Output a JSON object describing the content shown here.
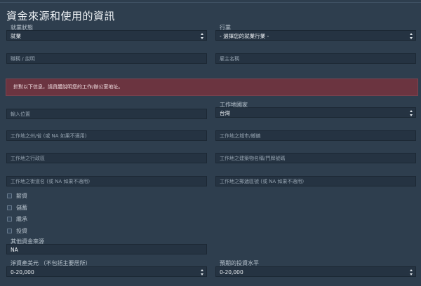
{
  "form": {
    "title": "資金來源和使用的資訊",
    "employment_status": {
      "label": "就業狀態",
      "value": "就業"
    },
    "industry": {
      "label": "行業",
      "value": "- 選擇您的就業行業 -"
    },
    "position_placeholder": "職稱 / 說明",
    "employer_placeholder": "雇主名稱",
    "alert_text": "針對以下信息，請具體說明您的工作/辦公室地址。",
    "location_placeholder": "輸入位置",
    "work_country": {
      "label": "工作地國家",
      "value": "台灣"
    },
    "state_placeholder": "工作地之州/省 (或 NA 如果不適用)",
    "city_placeholder": "工作地之城市/鄉鎮",
    "district_placeholder": "工作地之行政區",
    "building_placeholder": "工作地之建築物名稱/門牌號碼",
    "street_placeholder": "工作地之街道名 (或 NA 如果不適用)",
    "postal_placeholder": "工作地之郵遞區號 (或 NA 如果不適用)",
    "fund_sources": [
      {
        "label": "薪資"
      },
      {
        "label": "儲蓄"
      },
      {
        "label": "繼承"
      },
      {
        "label": "投資"
      }
    ],
    "other_source": {
      "label": "其他資金來源",
      "value": "NA"
    },
    "net_worth": {
      "label": "淨資產美元 （不包括主要居所）",
      "value": "0-20,000"
    },
    "expected_investment": {
      "label": "預期的投資水平",
      "value": "0-20,000"
    }
  }
}
